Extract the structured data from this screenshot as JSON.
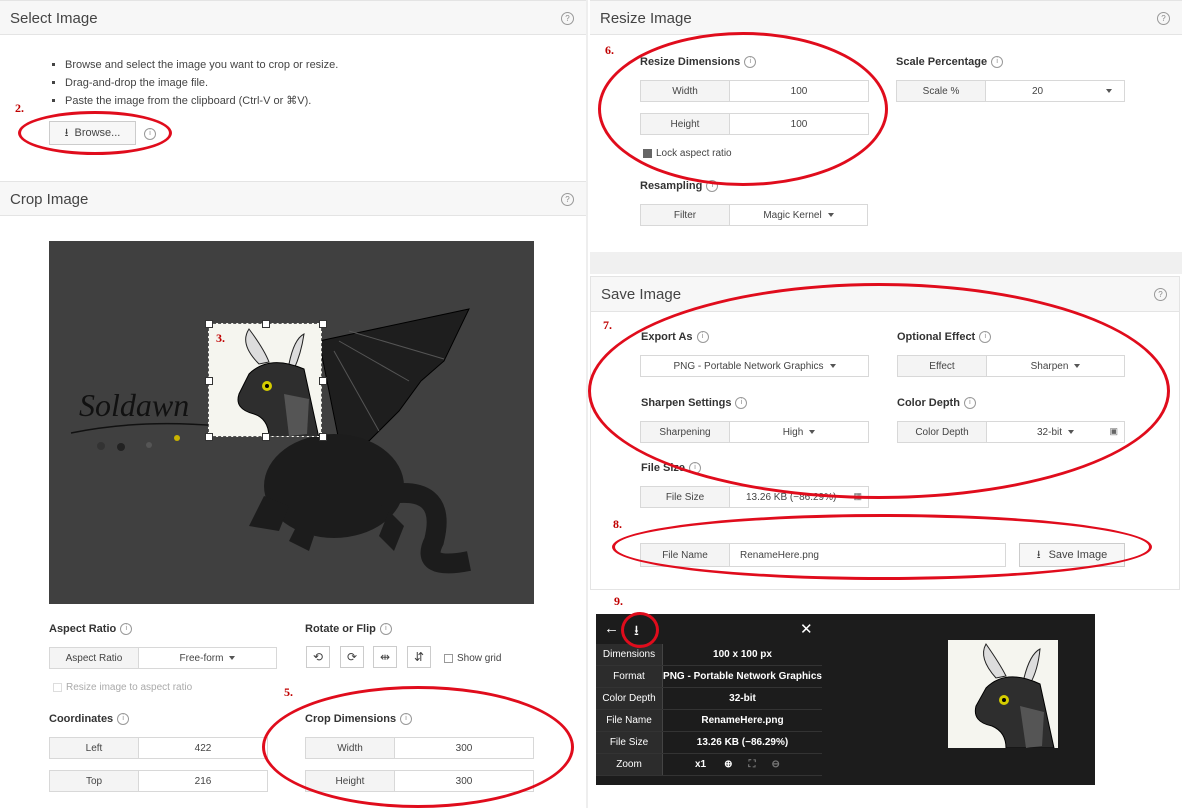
{
  "select_image": {
    "title": "Select Image",
    "bullets": [
      "Browse and select the image you want to crop or resize.",
      "Drag-and-drop the image file.",
      "Paste the image from the clipboard (Ctrl-V or ⌘V)."
    ],
    "browse_label": "Browse..."
  },
  "crop_image": {
    "title": "Crop Image",
    "aspect_ratio": {
      "label": "Aspect Ratio",
      "key": "Aspect Ratio",
      "value": "Free-form"
    },
    "resize_to_aspect": "Resize image to aspect ratio",
    "rotate_flip": {
      "label": "Rotate or Flip",
      "show_grid": "Show grid"
    },
    "coordinates": {
      "label": "Coordinates",
      "left_key": "Left",
      "left_value": "422",
      "top_key": "Top",
      "top_value": "216"
    },
    "crop_dimensions": {
      "label": "Crop Dimensions",
      "width_key": "Width",
      "width_value": "300",
      "height_key": "Height",
      "height_value": "300"
    },
    "artwork": {
      "signature": "Soldawn"
    }
  },
  "resize_image": {
    "title": "Resize Image",
    "dimensions": {
      "label": "Resize Dimensions",
      "width_key": "Width",
      "width_value": "100",
      "height_key": "Height",
      "height_value": "100",
      "lock": "Lock aspect ratio"
    },
    "scale": {
      "label": "Scale Percentage",
      "key": "Scale %",
      "value": "20"
    },
    "resampling": {
      "label": "Resampling",
      "key": "Filter",
      "value": "Magic Kernel"
    }
  },
  "save_image": {
    "title": "Save Image",
    "export_as": {
      "label": "Export As",
      "value": "PNG - Portable Network Graphics"
    },
    "optional_effect": {
      "label": "Optional Effect",
      "key": "Effect",
      "value": "Sharpen"
    },
    "sharpen": {
      "label": "Sharpen Settings",
      "key": "Sharpening",
      "value": "High"
    },
    "color_depth": {
      "label": "Color Depth",
      "key": "Color Depth",
      "value": "32-bit"
    },
    "file_size": {
      "label": "File Size",
      "key": "File Size",
      "value": "13.26 KB (−86.29%)"
    },
    "file_name": {
      "key": "File Name",
      "value": "RenameHere.png"
    },
    "save_label": "Save Image"
  },
  "details": {
    "rows": [
      {
        "key": "Dimensions",
        "value": "100 x 100 px"
      },
      {
        "key": "Format",
        "value": "PNG - Portable Network Graphics"
      },
      {
        "key": "Color Depth",
        "value": "32-bit"
      },
      {
        "key": "File Name",
        "value": "RenameHere.png"
      },
      {
        "key": "File Size",
        "value": "13.26 KB (−86.29%)"
      }
    ],
    "zoom_key": "Zoom",
    "zoom_value": "x1"
  },
  "annotations": [
    "2.",
    "3.",
    "5.",
    "6.",
    "7.",
    "8.",
    "9."
  ],
  "colors": {
    "annotation_red": "#e00c1c",
    "canvas_bg": "#404040",
    "dark_panel": "#1c1c1c"
  }
}
